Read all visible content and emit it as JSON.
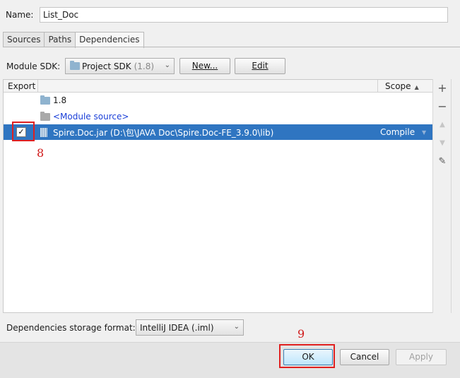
{
  "name": {
    "label": "Name:",
    "value": "List_Doc"
  },
  "tabs": [
    {
      "label": "Sources",
      "active": false
    },
    {
      "label": "Paths",
      "active": false
    },
    {
      "label": "Dependencies",
      "active": true
    }
  ],
  "sdk": {
    "label": "Module SDK:",
    "selected": "Project SDK",
    "selected_detail": "(1.8)",
    "new_label": "New...",
    "edit_label": "Edit"
  },
  "table": {
    "col_export": "Export",
    "col_scope": "Scope",
    "rows": [
      {
        "icon": "jdk-folder-icon",
        "label": "1.8"
      },
      {
        "icon": "module-source-folder-icon",
        "label": "<Module source>"
      },
      {
        "icon": "jar-icon",
        "label": "Spire.Doc.jar (D:\\包\\JAVA Doc\\Spire.Doc-FE_3.9.0\\lib)",
        "exported": true,
        "scope": "Compile",
        "selected": true
      }
    ]
  },
  "annotations": {
    "step8": "8",
    "step9": "9"
  },
  "format": {
    "label": "Dependencies storage format:",
    "selected": "IntelliJ IDEA (.iml)"
  },
  "footer": {
    "ok": "OK",
    "cancel": "Cancel",
    "apply": "Apply"
  },
  "colors": {
    "selection": "#2f75c1",
    "annotation": "#e02020",
    "link": "#1a3fd8"
  }
}
